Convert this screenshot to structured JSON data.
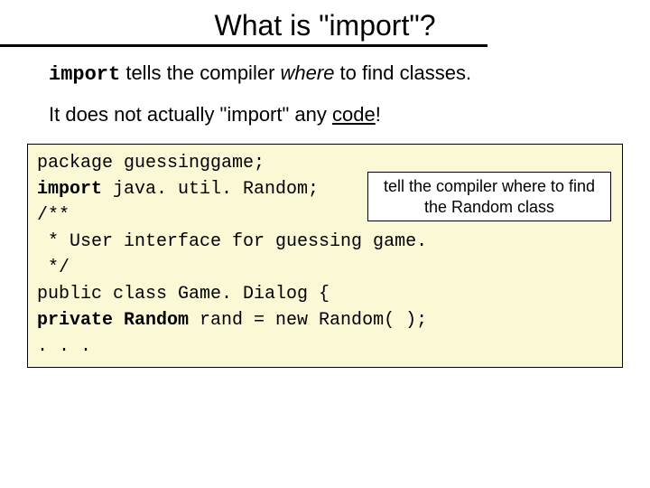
{
  "title": "What is \"import\"?",
  "body": {
    "p1_a": "import",
    "p1_b": " tells the compiler ",
    "p1_c": "where",
    "p1_d": " to find classes.",
    "p2_a": "It does not actually \"import\" any ",
    "p2_b": "code",
    "p2_c": "!"
  },
  "code": {
    "l1": "package guessinggame;",
    "l2a": "import",
    "l2b": " java. util. Random;",
    "l3": "/**",
    "l4": " * User interface for guessing game.",
    "l5": " */",
    "l6": "public class Game. Dialog {",
    "l7a": "private Random",
    "l7b": " rand = new Random( );",
    "l8": ". . ."
  },
  "callout": "tell the compiler where to find the Random class"
}
